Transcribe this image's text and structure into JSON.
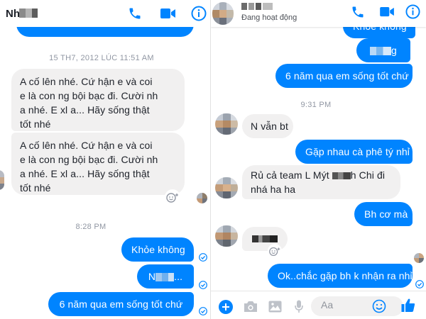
{
  "theme": {
    "accent": "#0084ff",
    "incoming_bubble": "#f1f0f0",
    "timestamp": "#9197a3"
  },
  "left": {
    "header": {
      "contact_name": "Nh",
      "icons": [
        "phone-icon",
        "video-camera-icon",
        "info-icon"
      ]
    },
    "timestamps": {
      "first": "15 TH7, 2012 LÚC 11:51 AM",
      "second": "8:28 PM"
    },
    "incoming": {
      "msg1": [
        "A cố lên nhé. Cứ hận e và coi",
        "e là con ng bội bạc đi. Cười nh",
        "a nhé. E xl a... Hãy sống thật",
        "tốt nhé"
      ],
      "msg2": [
        "A cố lên nhé. Cứ hận e và coi",
        "e là con ng bội bạc đi. Cười nh",
        "a nhé. E xl a... Hãy sống thật",
        "tốt nhé"
      ]
    },
    "outgoing": {
      "msg1": "Khỏe không",
      "msg2_prefix": "N",
      "msg2_suffix": "...",
      "msg3": "6 năm qua em sống tốt chứ"
    }
  },
  "right": {
    "header": {
      "status": "Đang hoạt động",
      "icons": [
        "phone-icon",
        "video-camera-icon",
        "info-icon"
      ]
    },
    "timestamps": {
      "first": "9:31 PM"
    },
    "outgoing": {
      "top": "Khỏe không",
      "mid_suffix": "g",
      "msg3": "6 năm qua em sống tốt chứ",
      "msg4": "Gặp nhau cà phê tý nhỉ",
      "msg5": "Bh cơ mà",
      "msg6": "Ok..chắc gặp bh k nhận ra nhỉ"
    },
    "incoming": {
      "msg1": "N vẫn bt",
      "msg2_line1_prefix": "Rủ cả team L Mýt",
      "msg2_line1_suffix": "h Chi đi",
      "msg2_line2": "nhá ha ha"
    },
    "composer": {
      "placeholder": "Aa",
      "icons": [
        "plus-icon",
        "camera-icon",
        "image-icon",
        "microphone-icon",
        "emoji-icon",
        "like-icon"
      ]
    }
  }
}
